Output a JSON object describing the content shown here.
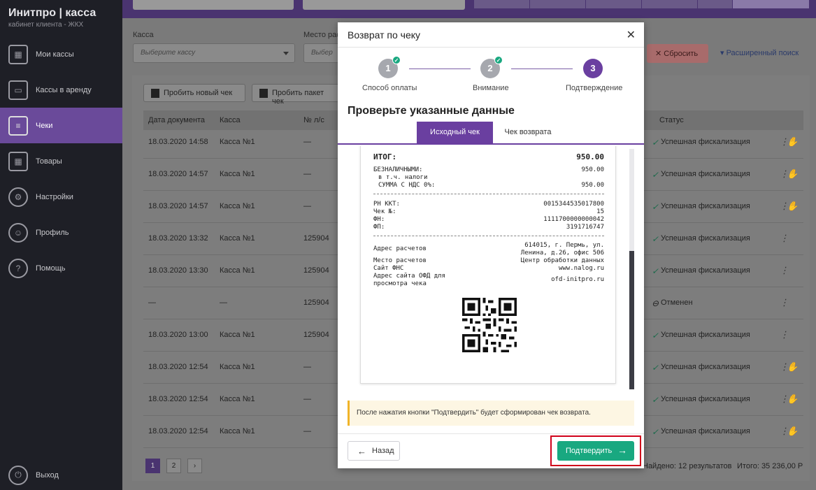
{
  "brand": {
    "title": "Инитпро | касса",
    "subtitle": "кабинет клиента - ЖКХ"
  },
  "sidebar": {
    "items": [
      {
        "label": "Мои кассы"
      },
      {
        "label": "Кассы в аренду"
      },
      {
        "label": "Чеки"
      },
      {
        "label": "Товары"
      },
      {
        "label": "Настройки"
      },
      {
        "label": "Профиль"
      },
      {
        "label": "Помощь"
      }
    ],
    "logout": "Выход"
  },
  "filters": {
    "kassa_label": "Касса",
    "kassa_placeholder": "Выберите кассу",
    "place_label": "Место рас",
    "place_placeholder": "Выбер",
    "reset": "✕ Сбросить",
    "advanced": "▾ Расширенный поиск"
  },
  "actions": {
    "new_check": "Пробить новый чек",
    "batch": "Пробить пакет чек"
  },
  "table": {
    "headers": {
      "date": "Дата документа",
      "kassa": "Касса",
      "ls": "№ л/с",
      "status": "Статус"
    },
    "rows": [
      {
        "date": "18.03.2020 14:58",
        "kassa": "Касса №1",
        "ls": "—",
        "status": "Успешная фискализация"
      },
      {
        "date": "18.03.2020 14:57",
        "kassa": "Касса №1",
        "ls": "—",
        "status": "Успешная фискализация"
      },
      {
        "date": "18.03.2020 14:57",
        "kassa": "Касса №1",
        "ls": "—",
        "status": "Успешная фискализация"
      },
      {
        "date": "18.03.2020 13:32",
        "kassa": "Касса №1",
        "ls": "125904",
        "status": "Успешная фискализация"
      },
      {
        "date": "18.03.2020 13:30",
        "kassa": "Касса №1",
        "ls": "125904",
        "status": "Успешная фискализация"
      },
      {
        "date": "—",
        "kassa": "—",
        "ls": "125904",
        "status": "Отменен"
      },
      {
        "date": "18.03.2020 13:00",
        "kassa": "Касса №1",
        "ls": "125904",
        "status": "Успешная фискализация"
      },
      {
        "date": "18.03.2020 12:54",
        "kassa": "Касса №1",
        "ls": "—",
        "status": "Успешная фискализация"
      },
      {
        "date": "18.03.2020 12:54",
        "kassa": "Касса №1",
        "ls": "—",
        "status": "Успешная фискализация"
      },
      {
        "date": "18.03.2020 12:54",
        "kassa": "Касса №1",
        "ls": "—",
        "status": "Успешная фискализация"
      }
    ]
  },
  "pagination": {
    "p1": "1",
    "p2": "2",
    "next": "›"
  },
  "footer": {
    "found": "Найдено: 12 результатов",
    "total": "Итого: 35 236,00 Р"
  },
  "modal": {
    "title": "Возврат по чеку",
    "steps": [
      {
        "num": "1",
        "label": "Способ оплаты"
      },
      {
        "num": "2",
        "label": "Внимание"
      },
      {
        "num": "3",
        "label": "Подтверждение"
      }
    ],
    "subtitle": "Проверьте указанные данные",
    "tabs": {
      "original": "Исходный чек",
      "refund": "Чек возврата"
    },
    "receipt": {
      "total_label": "ИТОГ:",
      "total_value": "950.00",
      "cashless_label": "БЕЗНАЛИЧНЫМИ:",
      "cashless_value": "950.00",
      "taxes_label": "в т.ч. налоги",
      "vat_label": "СУММА С НДС 0%:",
      "vat_value": "950.00",
      "rn_label": "РН ККТ:",
      "rn_value": "0015344535017800",
      "check_label": "Чек №:",
      "check_value": "15",
      "fn_label": "ФН:",
      "fn_value": "1111700000000042",
      "fp_label": "ФП:",
      "fp_value": "3191716747",
      "addr_label": "Адрес расчетов",
      "addr_value1": "614015, г. Пермь, ул.",
      "addr_value2": "Ленина, д.26, офис 506",
      "place_label": "Место расчетов",
      "place_value": "Центр обработки данных",
      "fns_label": "Сайт ФНС",
      "fns_value": "www.nalog.ru",
      "ofd_label1": "Адрес сайта ОФД для",
      "ofd_label2": "просмотра чека",
      "ofd_value": "ofd-initpro.ru"
    },
    "notice": "После нажатия кнопки \"Подтвердить\" будет сформирован чек возврата.",
    "back": "Назад",
    "confirm": "Подтвердить"
  },
  "colors": {
    "accent": "#6a3fa0",
    "success": "#19a880",
    "highlight": "#d0021b"
  }
}
